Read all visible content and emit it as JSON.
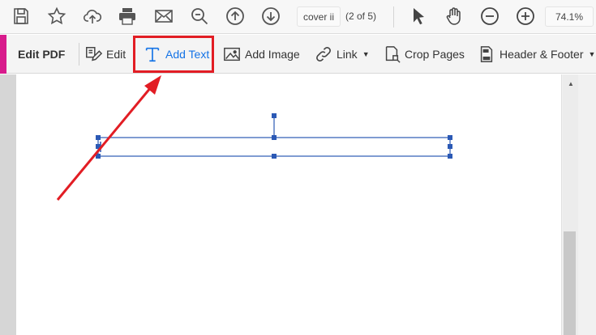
{
  "top_toolbar": {
    "icons": [
      "save-icon",
      "bookmark-star-icon",
      "upload-cloud-icon",
      "print-icon",
      "email-icon",
      "zoom-search-icon",
      "prev-page-icon",
      "next-page-icon"
    ],
    "page_label": "cover ii",
    "page_count": "(2 of 5)",
    "tools": [
      "select-pointer-icon",
      "hand-pan-icon",
      "zoom-out-icon",
      "zoom-in-icon"
    ],
    "zoom": "74.1%"
  },
  "edit_toolbar": {
    "title": "Edit PDF",
    "accent_color": "#d81b8c",
    "tools": {
      "edit": "Edit",
      "add_text": "Add Text",
      "add_image": "Add Image",
      "link": "Link",
      "crop_pages": "Crop Pages",
      "header_footer": "Header & Footer"
    },
    "active_tool_color": "#1473e6"
  },
  "annotation": {
    "highlight_color": "#e21d24",
    "arrow_color": "#e21d24"
  },
  "text_box": {
    "selection_color": "#2b59b5"
  }
}
